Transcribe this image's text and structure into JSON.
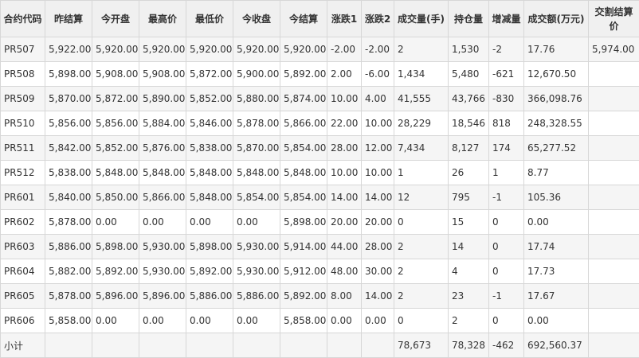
{
  "headers": [
    "合约代码",
    "昨结算",
    "今开盘",
    "最高价",
    "最低价",
    "今收盘",
    "今结算",
    "涨跌1",
    "涨跌2",
    "成交量(手)",
    "持仓量",
    "增减量",
    "成交额(万元)",
    "交割结算价"
  ],
  "rows": [
    [
      "PR507",
      "5,922.00",
      "5,920.00",
      "5,920.00",
      "5,920.00",
      "5,920.00",
      "5,920.00",
      "-2.00",
      "-2.00",
      "2",
      "1,530",
      "-2",
      "17.76",
      "5,974.00"
    ],
    [
      "PR508",
      "5,898.00",
      "5,908.00",
      "5,908.00",
      "5,872.00",
      "5,900.00",
      "5,892.00",
      "2.00",
      "-6.00",
      "1,434",
      "5,480",
      "-621",
      "12,670.50",
      ""
    ],
    [
      "PR509",
      "5,870.00",
      "5,872.00",
      "5,890.00",
      "5,852.00",
      "5,880.00",
      "5,874.00",
      "10.00",
      "4.00",
      "41,555",
      "43,766",
      "-830",
      "366,098.76",
      ""
    ],
    [
      "PR510",
      "5,856.00",
      "5,856.00",
      "5,884.00",
      "5,846.00",
      "5,878.00",
      "5,866.00",
      "22.00",
      "10.00",
      "28,229",
      "18,546",
      "818",
      "248,328.55",
      ""
    ],
    [
      "PR511",
      "5,842.00",
      "5,852.00",
      "5,876.00",
      "5,838.00",
      "5,870.00",
      "5,854.00",
      "28.00",
      "12.00",
      "7,434",
      "8,127",
      "174",
      "65,277.52",
      ""
    ],
    [
      "PR512",
      "5,838.00",
      "5,848.00",
      "5,848.00",
      "5,848.00",
      "5,848.00",
      "5,848.00",
      "10.00",
      "10.00",
      "1",
      "26",
      "1",
      "8.77",
      ""
    ],
    [
      "PR601",
      "5,840.00",
      "5,850.00",
      "5,866.00",
      "5,848.00",
      "5,854.00",
      "5,854.00",
      "14.00",
      "14.00",
      "12",
      "795",
      "-1",
      "105.36",
      ""
    ],
    [
      "PR602",
      "5,878.00",
      "0.00",
      "0.00",
      "0.00",
      "0.00",
      "5,898.00",
      "20.00",
      "20.00",
      "0",
      "15",
      "0",
      "0.00",
      ""
    ],
    [
      "PR603",
      "5,886.00",
      "5,898.00",
      "5,930.00",
      "5,898.00",
      "5,930.00",
      "5,914.00",
      "44.00",
      "28.00",
      "2",
      "14",
      "0",
      "17.74",
      ""
    ],
    [
      "PR604",
      "5,882.00",
      "5,892.00",
      "5,930.00",
      "5,892.00",
      "5,930.00",
      "5,912.00",
      "48.00",
      "30.00",
      "2",
      "4",
      "0",
      "17.73",
      ""
    ],
    [
      "PR605",
      "5,878.00",
      "5,896.00",
      "5,896.00",
      "5,886.00",
      "5,886.00",
      "5,892.00",
      "8.00",
      "14.00",
      "2",
      "23",
      "-1",
      "17.67",
      ""
    ],
    [
      "PR606",
      "5,858.00",
      "0.00",
      "0.00",
      "0.00",
      "0.00",
      "5,858.00",
      "0.00",
      "0.00",
      "0",
      "2",
      "0",
      "0.00",
      ""
    ]
  ],
  "subtotal": [
    "小计",
    "",
    "",
    "",
    "",
    "",
    "",
    "",
    "",
    "78,673",
    "78,328",
    "-462",
    "692,560.37",
    ""
  ]
}
